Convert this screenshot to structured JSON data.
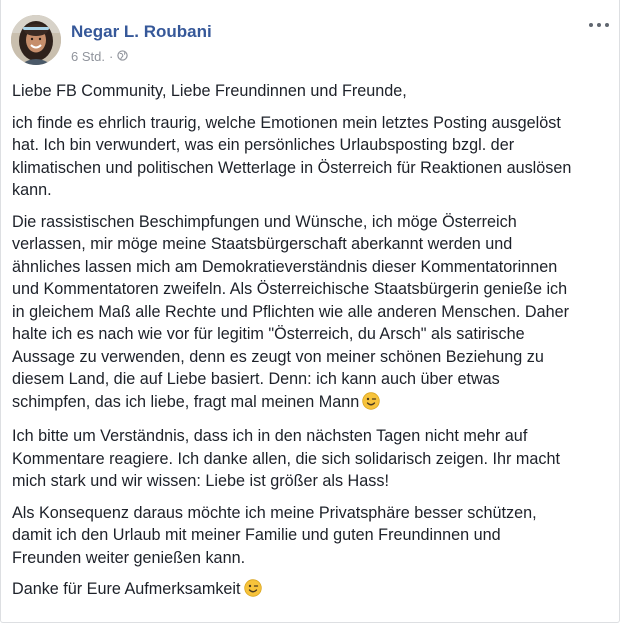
{
  "post": {
    "author": "Negar L. Roubani",
    "time": "6 Std.",
    "separator": "·",
    "privacy_icon": "globe-icon",
    "more_icon": "ellipsis-icon",
    "paragraphs": [
      "Liebe FB Community, Liebe Freundinnen und Freunde,",
      "ich finde es ehrlich traurig, welche Emotionen mein letztes Posting ausgelöst\nhat. Ich bin verwundert, was ein persönliches Urlaubsposting bzgl. der\nklimatischen und politischen Wetterlage in Österreich für Reaktionen auslösen\nkann.",
      "Die rassistischen Beschimpfungen und Wünsche, ich möge Österreich\nverlassen, mir möge meine Staatsbürgerschaft aberkannt werden und\nähnliches lassen mich am Demokratieverständnis dieser Kommentatorinnen\nund Kommentatoren zweifeln. Als Österreichische Staatsbürgerin genieße ich\nin gleichem Maß alle Rechte und Pflichten wie alle anderen Menschen. Daher\nhalte ich es nach wie vor für legitim \"Österreich, du Arsch\" als satirische\nAussage zu verwenden, denn es zeugt von meiner schönen Beziehung zu\ndiesem Land, die auf Liebe basiert. Denn: ich kann auch über etwas\nschimpfen, das ich liebe, fragt mal meinen Mann",
      "Ich bitte um Verständnis, dass ich in den nächsten Tagen nicht mehr auf\nKommentare reagiere. Ich danke allen, die sich solidarisch zeigen. Ihr macht\nmich stark und wir wissen: Liebe ist größer als Hass!",
      "Als Konsequenz daraus möchte ich meine Privatsphäre besser schützen,\ndamit ich den Urlaub mit meiner Familie und guten Freundinnen und\nFreunden weiter genießen kann.",
      "Danke für Eure Aufmerksamkeit"
    ],
    "emoji": "wink-emoji"
  },
  "colors": {
    "author": "#365899",
    "meta": "#90949c",
    "text": "#1d2129",
    "emoji": "#f7c33b"
  }
}
